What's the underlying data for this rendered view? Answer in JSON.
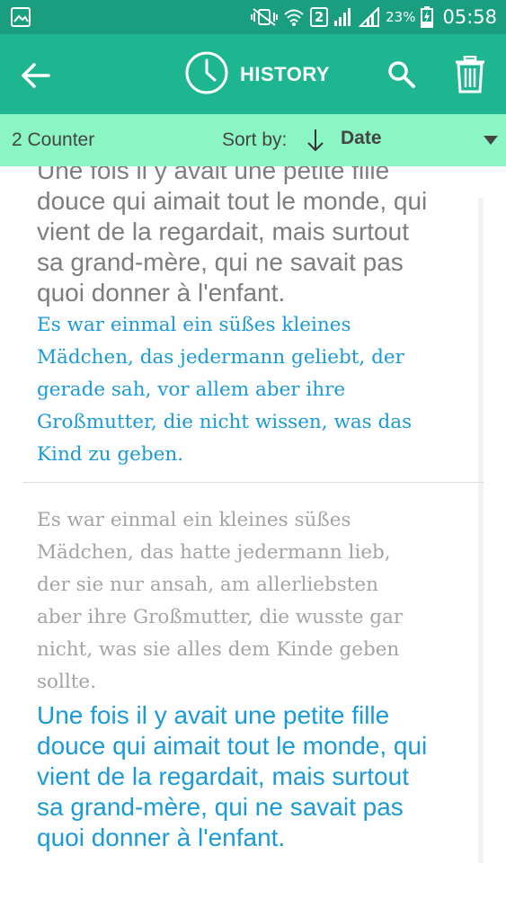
{
  "status_bar": {
    "battery_percent": "23%",
    "time": "05:58",
    "sim_slot": "2",
    "icons": [
      "gallery-notification-icon",
      "mute-vibrate-icon",
      "wifi-icon",
      "sim-2-icon",
      "signal-icon",
      "signal-icon",
      "battery-charging-icon"
    ]
  },
  "app_bar": {
    "title": "HISTORY",
    "icons": [
      "back-arrow-icon",
      "clock-icon",
      "search-icon",
      "trash-icon"
    ]
  },
  "sort_bar": {
    "counter": "2 Counter",
    "sort_label": "Sort by:",
    "sort_value": "Date",
    "icons": [
      "sort-down-arrow-icon",
      "dropdown-caret-icon"
    ]
  },
  "entries": [
    {
      "source": "Une fois il y avait une petite fille\ndouce qui aimait tout le monde, qui\nvient de la regardait, mais surtout\nsa grand-mère, qui ne savait pas\nquoi donner à l'enfant.",
      "translation": "Es war einmal ein süßes kleines\nMädchen, das jedermann geliebt, der\ngerade sah, vor allem aber ihre\nGroßmutter, die nicht wissen, was das\nKind zu geben."
    },
    {
      "source": "Es war einmal ein kleines süßes\nMädchen, das hatte jedermann lieb,\nder sie nur ansah, am allerliebsten\naber ihre Großmutter, die wusste gar\nnicht, was sie alles dem Kinde geben\nsollte.",
      "translation": "Une fois il y avait une petite fille\ndouce qui aimait tout le monde, qui\nvient de la regardait, mais surtout\nsa grand-mère, qui ne savait pas\nquoi donner à l'enfant."
    }
  ],
  "colors": {
    "status_bar": "#1a9e80",
    "app_bar": "#1db691",
    "sort_bar": "#8cf5c4",
    "translation_text": "#1a9ad6",
    "source_text": "#7d7d7d"
  }
}
